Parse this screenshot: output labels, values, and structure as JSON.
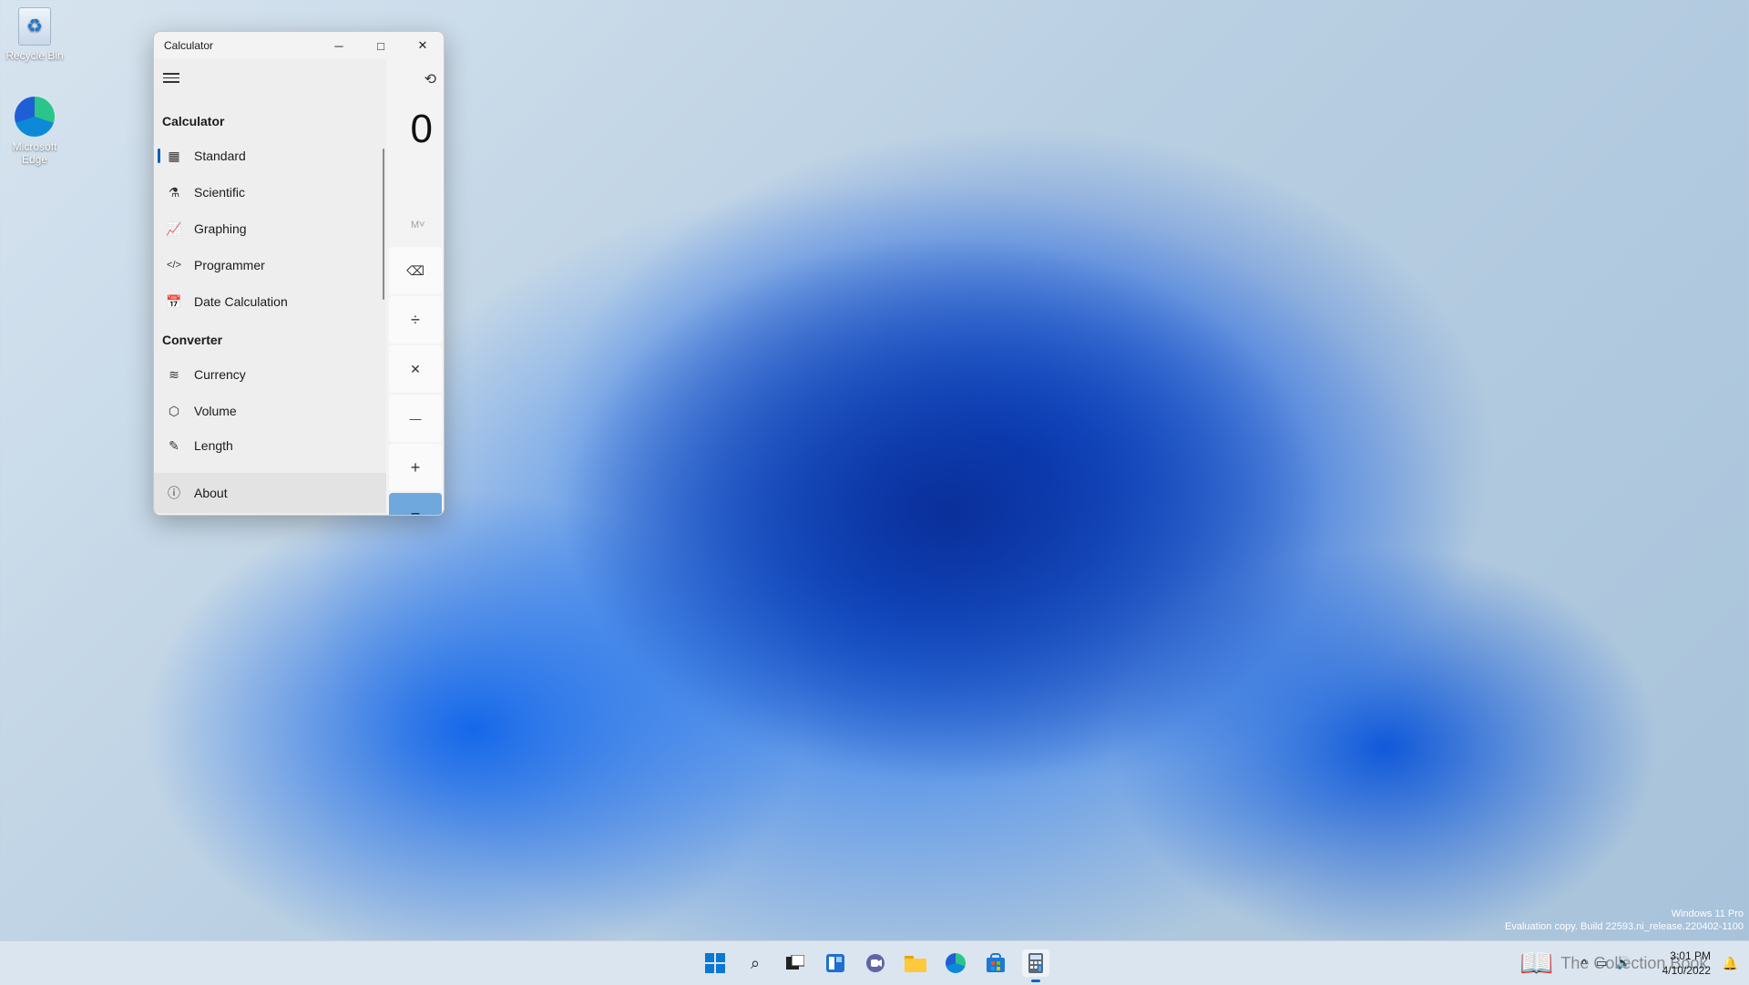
{
  "desktop": {
    "icons": [
      {
        "label": "Recycle Bin",
        "icon": "recycle-bin-icon"
      },
      {
        "label": "Microsoft Edge",
        "icon": "edge-icon"
      }
    ],
    "watermark": {
      "line1": "Windows 11 Pro",
      "line2": "Evaluation copy. Build 22593.ni_release.220402-1100"
    }
  },
  "window": {
    "title": "Calculator",
    "controls": {
      "minimize": "─",
      "maximize": "□",
      "close": "✕"
    }
  },
  "nav": {
    "section_calculator": "Calculator",
    "calculator_items": [
      {
        "label": "Standard",
        "icon": "▦",
        "active": true
      },
      {
        "label": "Scientific",
        "icon": "⚗"
      },
      {
        "label": "Graphing",
        "icon": "📈"
      },
      {
        "label": "Programmer",
        "icon": "</>"
      },
      {
        "label": "Date Calculation",
        "icon": "📅"
      }
    ],
    "section_converter": "Converter",
    "converter_items": [
      {
        "label": "Currency",
        "icon": "≋"
      },
      {
        "label": "Volume",
        "icon": "⬡"
      },
      {
        "label": "Length",
        "icon": "✎"
      }
    ],
    "about": {
      "label": "About",
      "icon": "ⓘ"
    }
  },
  "calculator": {
    "display_value": "0",
    "memory_label": "M˅",
    "keys": [
      "⌫",
      "÷",
      "✕",
      "—",
      "+",
      "="
    ]
  },
  "taskbar": {
    "clock_time": "3:01 PM",
    "clock_date": "4/10/2022",
    "overlay_text": "The Collection Book",
    "accent_color": "#0067c0"
  }
}
